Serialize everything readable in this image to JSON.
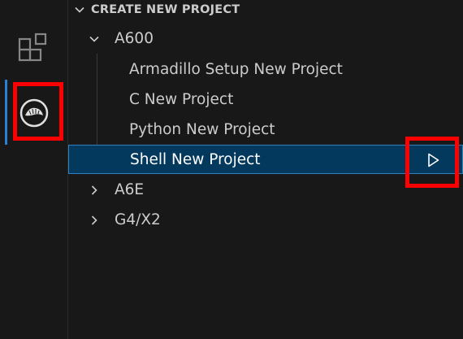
{
  "activity_bar": {
    "items": [
      {
        "name": "extensions",
        "icon": "extensions-icon"
      },
      {
        "name": "armadillo",
        "icon": "armadillo-logo-icon",
        "active": true
      }
    ]
  },
  "panel": {
    "section_title": "CREATE NEW PROJECT",
    "tree": {
      "a600": {
        "label": "A600",
        "expanded": true,
        "children": [
          "Armadillo Setup New Project",
          "C New Project",
          "Python New Project",
          "Shell New Project"
        ],
        "selected_child": "Shell New Project"
      },
      "a6e": {
        "label": "A6E",
        "expanded": false
      },
      "g4x2": {
        "label": "G4/X2",
        "expanded": false
      }
    },
    "run_action_icon": "play-icon"
  },
  "colors": {
    "background": "#181818",
    "selection": "#04395e",
    "selection_border": "#2f7fc1",
    "highlight_box": "#ff0000",
    "text": "#cccccc"
  }
}
